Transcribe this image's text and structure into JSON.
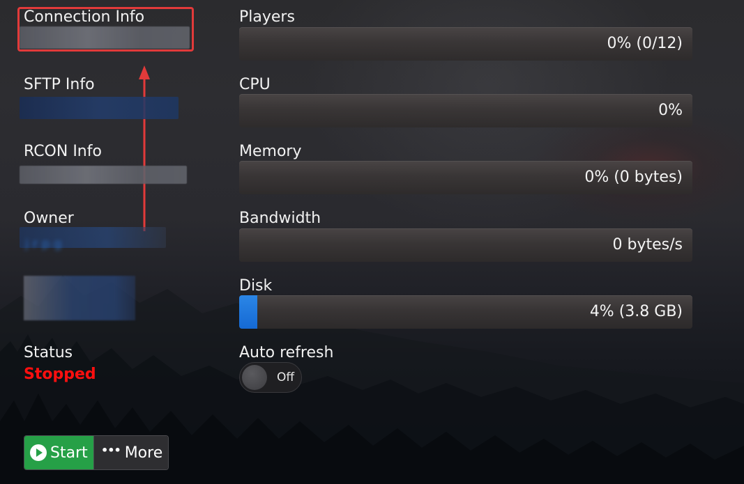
{
  "left": {
    "connection_label": "Connection Info",
    "sftp_label": "SFTP Info",
    "rcon_label": "RCON Info",
    "owner_label": "Owner",
    "owner_value": "j r p g",
    "status_label": "Status",
    "status_value": "Stopped"
  },
  "stats": {
    "players": {
      "label": "Players",
      "text": "0% (0/12)",
      "percent": 0
    },
    "cpu": {
      "label": "CPU",
      "text": "0%",
      "percent": 0
    },
    "memory": {
      "label": "Memory",
      "text": "0% (0 bytes)",
      "percent": 0
    },
    "bandwidth": {
      "label": "Bandwidth",
      "text": "0 bytes/s",
      "percent": 0
    },
    "disk": {
      "label": "Disk",
      "text": "4% (3.8 GB)",
      "percent": 4
    }
  },
  "auto_refresh": {
    "label": "Auto refresh",
    "state": "Off"
  },
  "actions": {
    "start_label": "Start",
    "more_label": "More",
    "more_icon": "•••"
  },
  "colors": {
    "status_stopped": "#ff0f0f",
    "start_button": "#26a047",
    "disk_fill": "#1569d4",
    "highlight": "#e23a3a"
  },
  "icons": {
    "start": "play-circle-icon",
    "more": "ellipsis-icon",
    "annotation": "arrow-up-icon"
  }
}
